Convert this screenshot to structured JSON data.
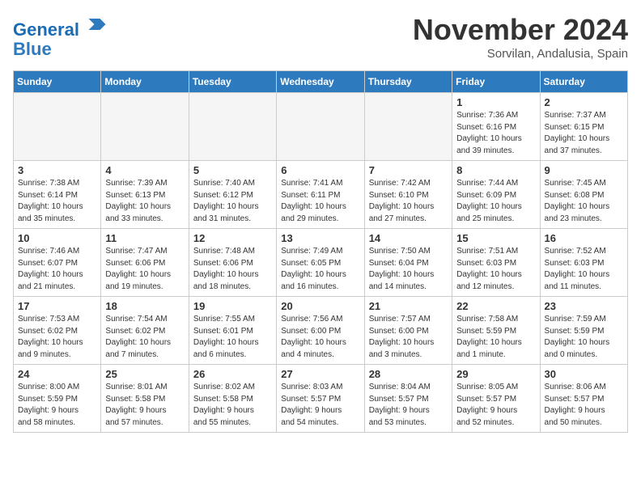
{
  "header": {
    "logo_line1": "General",
    "logo_line2": "Blue",
    "month_title": "November 2024",
    "location": "Sorvilan, Andalusia, Spain"
  },
  "weekdays": [
    "Sunday",
    "Monday",
    "Tuesday",
    "Wednesday",
    "Thursday",
    "Friday",
    "Saturday"
  ],
  "weeks": [
    [
      {
        "day": "",
        "info": ""
      },
      {
        "day": "",
        "info": ""
      },
      {
        "day": "",
        "info": ""
      },
      {
        "day": "",
        "info": ""
      },
      {
        "day": "",
        "info": ""
      },
      {
        "day": "1",
        "info": "Sunrise: 7:36 AM\nSunset: 6:16 PM\nDaylight: 10 hours\nand 39 minutes."
      },
      {
        "day": "2",
        "info": "Sunrise: 7:37 AM\nSunset: 6:15 PM\nDaylight: 10 hours\nand 37 minutes."
      }
    ],
    [
      {
        "day": "3",
        "info": "Sunrise: 7:38 AM\nSunset: 6:14 PM\nDaylight: 10 hours\nand 35 minutes."
      },
      {
        "day": "4",
        "info": "Sunrise: 7:39 AM\nSunset: 6:13 PM\nDaylight: 10 hours\nand 33 minutes."
      },
      {
        "day": "5",
        "info": "Sunrise: 7:40 AM\nSunset: 6:12 PM\nDaylight: 10 hours\nand 31 minutes."
      },
      {
        "day": "6",
        "info": "Sunrise: 7:41 AM\nSunset: 6:11 PM\nDaylight: 10 hours\nand 29 minutes."
      },
      {
        "day": "7",
        "info": "Sunrise: 7:42 AM\nSunset: 6:10 PM\nDaylight: 10 hours\nand 27 minutes."
      },
      {
        "day": "8",
        "info": "Sunrise: 7:44 AM\nSunset: 6:09 PM\nDaylight: 10 hours\nand 25 minutes."
      },
      {
        "day": "9",
        "info": "Sunrise: 7:45 AM\nSunset: 6:08 PM\nDaylight: 10 hours\nand 23 minutes."
      }
    ],
    [
      {
        "day": "10",
        "info": "Sunrise: 7:46 AM\nSunset: 6:07 PM\nDaylight: 10 hours\nand 21 minutes."
      },
      {
        "day": "11",
        "info": "Sunrise: 7:47 AM\nSunset: 6:06 PM\nDaylight: 10 hours\nand 19 minutes."
      },
      {
        "day": "12",
        "info": "Sunrise: 7:48 AM\nSunset: 6:06 PM\nDaylight: 10 hours\nand 18 minutes."
      },
      {
        "day": "13",
        "info": "Sunrise: 7:49 AM\nSunset: 6:05 PM\nDaylight: 10 hours\nand 16 minutes."
      },
      {
        "day": "14",
        "info": "Sunrise: 7:50 AM\nSunset: 6:04 PM\nDaylight: 10 hours\nand 14 minutes."
      },
      {
        "day": "15",
        "info": "Sunrise: 7:51 AM\nSunset: 6:03 PM\nDaylight: 10 hours\nand 12 minutes."
      },
      {
        "day": "16",
        "info": "Sunrise: 7:52 AM\nSunset: 6:03 PM\nDaylight: 10 hours\nand 11 minutes."
      }
    ],
    [
      {
        "day": "17",
        "info": "Sunrise: 7:53 AM\nSunset: 6:02 PM\nDaylight: 10 hours\nand 9 minutes."
      },
      {
        "day": "18",
        "info": "Sunrise: 7:54 AM\nSunset: 6:02 PM\nDaylight: 10 hours\nand 7 minutes."
      },
      {
        "day": "19",
        "info": "Sunrise: 7:55 AM\nSunset: 6:01 PM\nDaylight: 10 hours\nand 6 minutes."
      },
      {
        "day": "20",
        "info": "Sunrise: 7:56 AM\nSunset: 6:00 PM\nDaylight: 10 hours\nand 4 minutes."
      },
      {
        "day": "21",
        "info": "Sunrise: 7:57 AM\nSunset: 6:00 PM\nDaylight: 10 hours\nand 3 minutes."
      },
      {
        "day": "22",
        "info": "Sunrise: 7:58 AM\nSunset: 5:59 PM\nDaylight: 10 hours\nand 1 minute."
      },
      {
        "day": "23",
        "info": "Sunrise: 7:59 AM\nSunset: 5:59 PM\nDaylight: 10 hours\nand 0 minutes."
      }
    ],
    [
      {
        "day": "24",
        "info": "Sunrise: 8:00 AM\nSunset: 5:59 PM\nDaylight: 9 hours\nand 58 minutes."
      },
      {
        "day": "25",
        "info": "Sunrise: 8:01 AM\nSunset: 5:58 PM\nDaylight: 9 hours\nand 57 minutes."
      },
      {
        "day": "26",
        "info": "Sunrise: 8:02 AM\nSunset: 5:58 PM\nDaylight: 9 hours\nand 55 minutes."
      },
      {
        "day": "27",
        "info": "Sunrise: 8:03 AM\nSunset: 5:57 PM\nDaylight: 9 hours\nand 54 minutes."
      },
      {
        "day": "28",
        "info": "Sunrise: 8:04 AM\nSunset: 5:57 PM\nDaylight: 9 hours\nand 53 minutes."
      },
      {
        "day": "29",
        "info": "Sunrise: 8:05 AM\nSunset: 5:57 PM\nDaylight: 9 hours\nand 52 minutes."
      },
      {
        "day": "30",
        "info": "Sunrise: 8:06 AM\nSunset: 5:57 PM\nDaylight: 9 hours\nand 50 minutes."
      }
    ]
  ]
}
